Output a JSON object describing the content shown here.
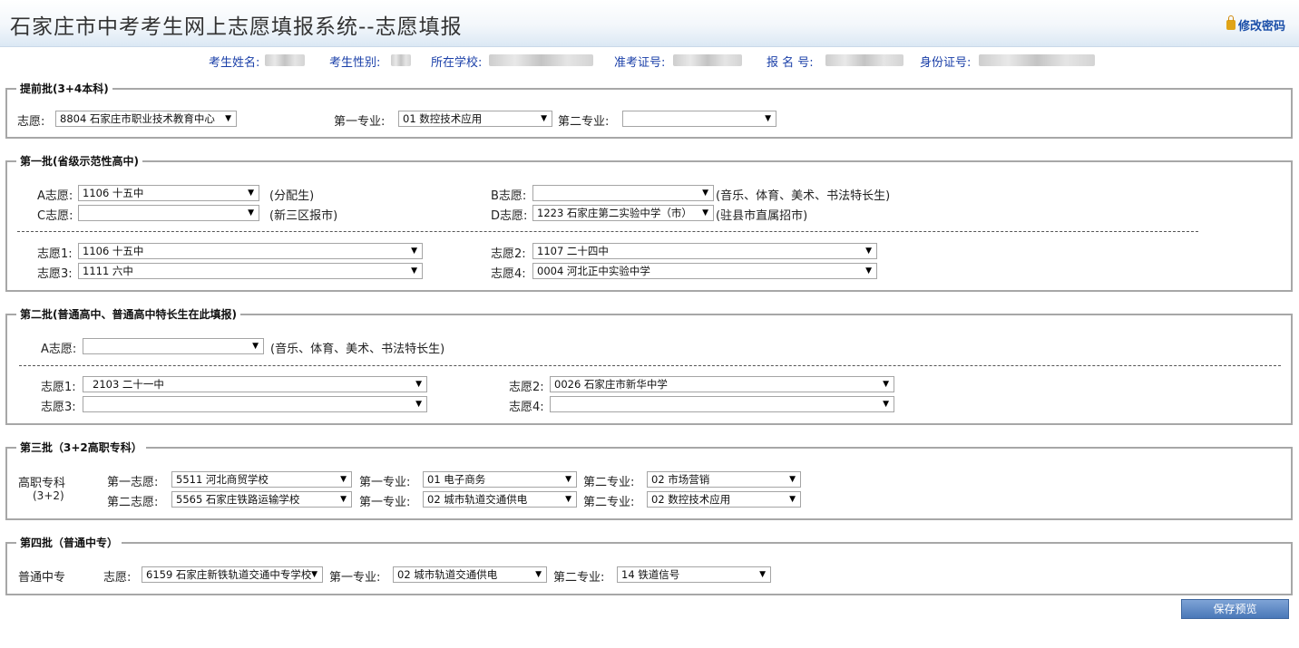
{
  "header": {
    "title": "石家庄市中考考生网上志愿填报系统--志愿填报",
    "change_password": "修改密码"
  },
  "info": {
    "name_label": "考生姓名:",
    "gender_label": "考生性别:",
    "school_label": "所在学校:",
    "exam_no_label": "准考证号:",
    "reg_no_label": "报 名 号:",
    "id_label": "身份证号:"
  },
  "batch0": {
    "legend": "提前批(3+4本科)",
    "volunteer_label": "志愿:",
    "volunteer_value": "8804 石家庄市职业技术教育中心",
    "major1_label": "第一专业:",
    "major1_value": "01 数控技术应用",
    "major2_label": "第二专业:",
    "major2_value": ""
  },
  "batch1": {
    "legend": "第一批(省级示范性高中)",
    "a_label": "A志愿:",
    "a_value": "1106 十五中",
    "a_note": "(分配生)",
    "b_label": "B志愿:",
    "b_value": "",
    "b_note": "(音乐、体育、美术、书法特长生)",
    "c_label": "C志愿:",
    "c_value": "",
    "c_note": "(新三区报市)",
    "d_label": "D志愿:",
    "d_value": "1223 石家庄第二实验中学（市）",
    "d_note": "(驻县市直属招市)",
    "v1_label": "志愿1:",
    "v1_value": "1106 十五中",
    "v2_label": "志愿2:",
    "v2_value": "1107 二十四中",
    "v3_label": "志愿3:",
    "v3_value": "1111 六中",
    "v4_label": "志愿4:",
    "v4_value": "0004 河北正中实验中学"
  },
  "batch2": {
    "legend": "第二批(普通高中、普通高中特长生在此填报)",
    "a_label": "A志愿:",
    "a_value": "",
    "a_note": "(音乐、体育、美术、书法特长生)",
    "v1_label": "志愿1:",
    "v1_value": "2103 二十一中",
    "v2_label": "志愿2:",
    "v2_value": "0026 石家庄市新华中学",
    "v3_label": "志愿3:",
    "v3_value": "",
    "v4_label": "志愿4:",
    "v4_value": ""
  },
  "batch3": {
    "legend": "第三批（3+2高职专科）",
    "category_line1": "高职专科",
    "category_line2": "(3+2)",
    "first_label": "第一志愿:",
    "first_value": "5511 河北商贸学校",
    "first_m1_label": "第一专业:",
    "first_m1_value": "01 电子商务",
    "first_m2_label": "第二专业:",
    "first_m2_value": "02 市场营销",
    "second_label": "第二志愿:",
    "second_value": "5565 石家庄铁路运输学校",
    "second_m1_label": "第一专业:",
    "second_m1_value": "02 城市轨道交通供电",
    "second_m2_label": "第二专业:",
    "second_m2_value": "02 数控技术应用"
  },
  "batch4": {
    "legend": "第四批（普通中专）",
    "category": "普通中专",
    "volunteer_label": "志愿:",
    "volunteer_value": "6159 石家庄新铁轨道交通中专学校",
    "m1_label": "第一专业:",
    "m1_value": "02 城市轨道交通供电",
    "m2_label": "第二专业:",
    "m2_value": "14 铁道信号"
  },
  "save_button": "保存预览",
  "arrow_icon": "▼"
}
